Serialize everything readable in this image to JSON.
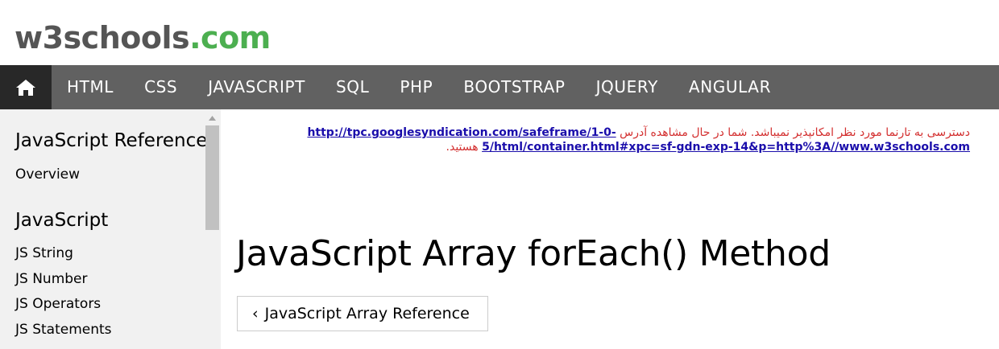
{
  "logo": {
    "main": "w3schools",
    "suffix": ".com"
  },
  "topnav": {
    "home_icon": "home-icon",
    "items": [
      "HTML",
      "CSS",
      "JAVASCRIPT",
      "SQL",
      "PHP",
      "BOOTSTRAP",
      "JQUERY",
      "ANGULAR"
    ]
  },
  "sidebar": {
    "heading_reference": "JavaScript Reference",
    "overview": "Overview",
    "heading_js": "JavaScript",
    "links": [
      "JS String",
      "JS Number",
      "JS Operators",
      "JS Statements"
    ]
  },
  "ad_notice": {
    "text_before": "دسترسی به تارنما مورد نظر امکانپذیر نمیباشد. شما در حال مشاهده آدرس",
    "url": "http://tpc.googlesyndication.com/safeframe/1-0-5/html/container.html#xpc=sf-gdn-exp-14&p=http%3A//www.w3schools.com",
    "text_after": "هستید."
  },
  "main": {
    "title": "JavaScript Array forEach() Method",
    "back_button": "JavaScript Array Reference"
  },
  "colors": {
    "logo_gray": "#555555",
    "logo_green": "#4CAF50",
    "nav_bg": "#616161",
    "home_bg": "#282828",
    "sidebar_bg": "#f1f1f1"
  }
}
